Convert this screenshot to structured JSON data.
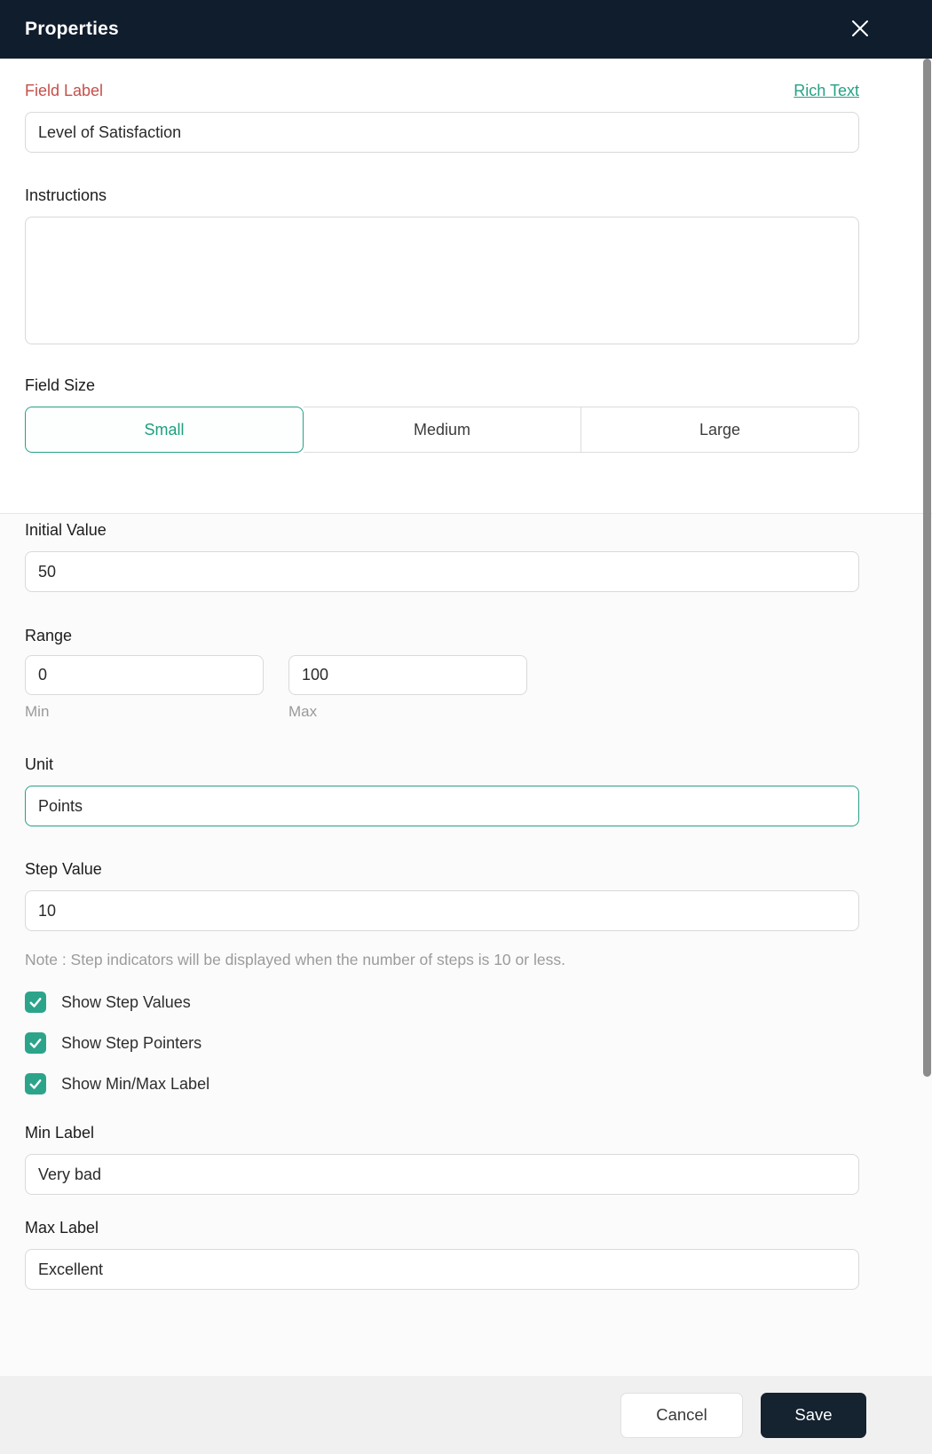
{
  "header": {
    "title": "Properties"
  },
  "field_label": {
    "label": "Field Label",
    "rich_text_link": "Rich Text",
    "value": "Level of Satisfaction"
  },
  "instructions": {
    "label": "Instructions",
    "value": ""
  },
  "field_size": {
    "label": "Field Size",
    "options": [
      "Small",
      "Medium",
      "Large"
    ],
    "selected": "Small"
  },
  "initial_value": {
    "label": "Initial Value",
    "value": "50"
  },
  "range": {
    "label": "Range",
    "min": {
      "value": "0",
      "caption": "Min"
    },
    "max": {
      "value": "100",
      "caption": "Max"
    }
  },
  "unit": {
    "label": "Unit",
    "value": "Points"
  },
  "step_value": {
    "label": "Step Value",
    "value": "10"
  },
  "note": "Note : Step indicators will be displayed when the number of steps is 10 or less.",
  "checkboxes": [
    {
      "label": "Show Step Values",
      "checked": true
    },
    {
      "label": "Show Step Pointers",
      "checked": true
    },
    {
      "label": "Show Min/Max Label",
      "checked": true
    }
  ],
  "min_label": {
    "label": "Min Label",
    "value": "Very bad"
  },
  "max_label": {
    "label": "Max Label",
    "value": "Excellent"
  },
  "footer": {
    "cancel_label": "Cancel",
    "save_label": "Save"
  },
  "colors": {
    "header_bg": "#101d2d",
    "accent_teal": "#27a186",
    "checkbox_teal": "#2ca48a",
    "field_label_red": "#c4504c",
    "save_button_bg": "#15222f",
    "footer_bg": "#f0f0f1",
    "section_bottom_bg": "#fbfbfb",
    "note_gray": "#9b9b9b",
    "input_border": "#d9d9d9"
  }
}
